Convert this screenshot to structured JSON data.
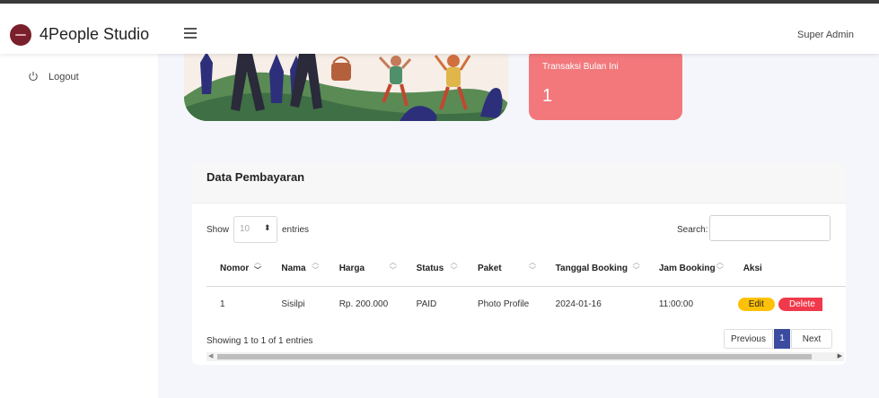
{
  "header": {
    "brand": "4People Studio",
    "user": "Super Admin"
  },
  "sidebar": {
    "logout_label": "Logout"
  },
  "stat_card": {
    "label": "Transaksi Bulan Ini",
    "value": "1",
    "color": "#f2787c"
  },
  "panel": {
    "title": "Data Pembayaran",
    "show_label": "Show",
    "page_length": "10",
    "entries_label": "entries",
    "search_label": "Search:",
    "search_value": "",
    "columns": [
      "Nomor",
      "Nama",
      "Harga",
      "Status",
      "Paket",
      "Tanggal Booking",
      "Jam Booking",
      "Aksi"
    ],
    "rows": [
      {
        "nomor": "1",
        "nama": "Sisilpi",
        "harga": "Rp. 200.000",
        "status": "PAID",
        "paket": "Photo Profile",
        "tanggal": "2024-01-16",
        "jam": "11:00:00",
        "edit_label": "Edit",
        "delete_label": "Delete"
      }
    ],
    "info": "Showing 1 to 1 of 1 entries",
    "pager": {
      "previous": "Previous",
      "current": "1",
      "next": "Next"
    }
  }
}
